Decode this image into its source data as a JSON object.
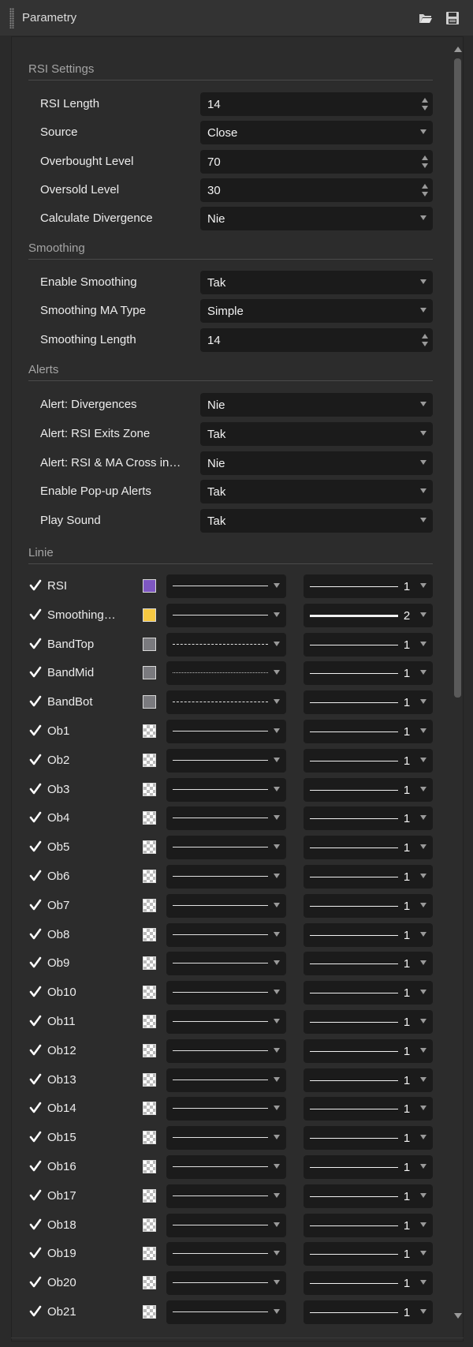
{
  "window": {
    "title": "Parametry",
    "icons": [
      "folder-open-icon",
      "save-icon"
    ]
  },
  "sections": {
    "rsi": {
      "title": "RSI Settings",
      "rows": [
        {
          "label": "RSI Length",
          "value": "14",
          "kind": "spin"
        },
        {
          "label": "Source",
          "value": "Close",
          "kind": "select"
        },
        {
          "label": "Overbought Level",
          "value": "70",
          "kind": "spin"
        },
        {
          "label": "Oversold Level",
          "value": "30",
          "kind": "spin"
        },
        {
          "label": "Calculate Divergence",
          "value": "Nie",
          "kind": "select"
        }
      ]
    },
    "smoothing": {
      "title": "Smoothing",
      "rows": [
        {
          "label": "Enable Smoothing",
          "value": "Tak",
          "kind": "select"
        },
        {
          "label": "Smoothing MA Type",
          "value": "Simple",
          "kind": "select"
        },
        {
          "label": "Smoothing Length",
          "value": "14",
          "kind": "spin"
        }
      ]
    },
    "alerts": {
      "title": "Alerts",
      "rows": [
        {
          "label": "Alert: Divergences",
          "value": "Nie",
          "kind": "select"
        },
        {
          "label": "Alert: RSI Exits Zone",
          "value": "Tak",
          "kind": "select"
        },
        {
          "label": "Alert: RSI & MA Cross in…",
          "value": "Nie",
          "kind": "select"
        },
        {
          "label": "Enable Pop-up Alerts",
          "value": "Tak",
          "kind": "select"
        },
        {
          "label": "Play Sound",
          "value": "Tak",
          "kind": "select"
        }
      ]
    },
    "lines": {
      "title": "Linie",
      "rows": [
        {
          "name": "RSI",
          "checked": true,
          "color": "#7e57c2",
          "style": "solid",
          "width": "1"
        },
        {
          "name": "Smoothing…",
          "checked": true,
          "color": "#f5c842",
          "style": "solid",
          "width": "2"
        },
        {
          "name": "BandTop",
          "checked": true,
          "color": "#7a7a7e",
          "style": "dashed",
          "width": "1"
        },
        {
          "name": "BandMid",
          "checked": true,
          "color": "#7a7a7e",
          "style": "dotted",
          "width": "1"
        },
        {
          "name": "BandBot",
          "checked": true,
          "color": "#7a7a7e",
          "style": "dashed",
          "width": "1"
        },
        {
          "name": "Ob1",
          "checked": true,
          "color": "transparent",
          "style": "solid",
          "width": "1"
        },
        {
          "name": "Ob2",
          "checked": true,
          "color": "transparent",
          "style": "solid",
          "width": "1"
        },
        {
          "name": "Ob3",
          "checked": true,
          "color": "transparent",
          "style": "solid",
          "width": "1"
        },
        {
          "name": "Ob4",
          "checked": true,
          "color": "transparent",
          "style": "solid",
          "width": "1"
        },
        {
          "name": "Ob5",
          "checked": true,
          "color": "transparent",
          "style": "solid",
          "width": "1"
        },
        {
          "name": "Ob6",
          "checked": true,
          "color": "transparent",
          "style": "solid",
          "width": "1"
        },
        {
          "name": "Ob7",
          "checked": true,
          "color": "transparent",
          "style": "solid",
          "width": "1"
        },
        {
          "name": "Ob8",
          "checked": true,
          "color": "transparent",
          "style": "solid",
          "width": "1"
        },
        {
          "name": "Ob9",
          "checked": true,
          "color": "transparent",
          "style": "solid",
          "width": "1"
        },
        {
          "name": "Ob10",
          "checked": true,
          "color": "transparent",
          "style": "solid",
          "width": "1"
        },
        {
          "name": "Ob11",
          "checked": true,
          "color": "transparent",
          "style": "solid",
          "width": "1"
        },
        {
          "name": "Ob12",
          "checked": true,
          "color": "transparent",
          "style": "solid",
          "width": "1"
        },
        {
          "name": "Ob13",
          "checked": true,
          "color": "transparent",
          "style": "solid",
          "width": "1"
        },
        {
          "name": "Ob14",
          "checked": true,
          "color": "transparent",
          "style": "solid",
          "width": "1"
        },
        {
          "name": "Ob15",
          "checked": true,
          "color": "transparent",
          "style": "solid",
          "width": "1"
        },
        {
          "name": "Ob16",
          "checked": true,
          "color": "transparent",
          "style": "solid",
          "width": "1"
        },
        {
          "name": "Ob17",
          "checked": true,
          "color": "transparent",
          "style": "solid",
          "width": "1"
        },
        {
          "name": "Ob18",
          "checked": true,
          "color": "transparent",
          "style": "solid",
          "width": "1"
        },
        {
          "name": "Ob19",
          "checked": true,
          "color": "transparent",
          "style": "solid",
          "width": "1"
        },
        {
          "name": "Ob20",
          "checked": true,
          "color": "transparent",
          "style": "solid",
          "width": "1"
        },
        {
          "name": "Ob21",
          "checked": true,
          "color": "transparent",
          "style": "solid",
          "width": "1"
        }
      ]
    }
  }
}
